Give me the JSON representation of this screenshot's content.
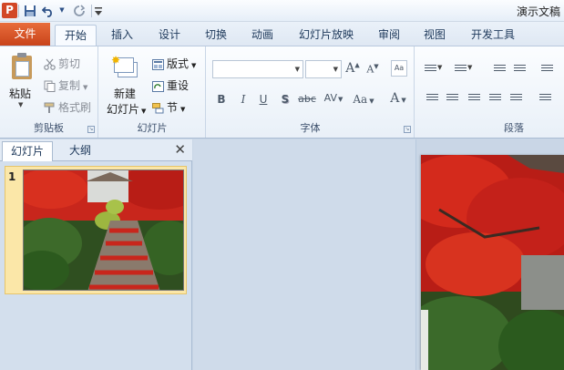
{
  "app": {
    "title": "演示文稿",
    "ppt_icon": "P",
    "qat": [
      "save-icon",
      "undo-icon",
      "redo-icon",
      "customize-icon"
    ]
  },
  "tabs": [
    {
      "label": "文件",
      "kind": "file"
    },
    {
      "label": "开始",
      "kind": "active"
    },
    {
      "label": "插入"
    },
    {
      "label": "设计"
    },
    {
      "label": "切换"
    },
    {
      "label": "动画"
    },
    {
      "label": "幻灯片放映"
    },
    {
      "label": "审阅"
    },
    {
      "label": "视图"
    },
    {
      "label": "开发工具"
    }
  ],
  "ribbon": {
    "clipboard": {
      "label": "剪贴板",
      "paste": "粘贴",
      "cut": "剪切",
      "copy": "复制",
      "format_painter": "格式刷"
    },
    "slides": {
      "label": "幻灯片",
      "new_slide_line1": "新建",
      "new_slide_line2": "幻灯片",
      "layout": "版式",
      "reset": "重设",
      "section": "节"
    },
    "font": {
      "label": "字体",
      "font_name": "",
      "font_size": "",
      "grow": "A",
      "shrink": "A",
      "bold": "B",
      "italic": "I",
      "underline": "U",
      "shadow": "S",
      "strike": "abc",
      "spacing": "AV",
      "case": "Aa",
      "color": "A"
    },
    "paragraph": {
      "label": "段落"
    }
  },
  "leftpane": {
    "tab_slides": "幻灯片",
    "tab_outline": "大纲",
    "slide_number": "1"
  },
  "colors": {
    "file_tab": "#d24726",
    "accent": "#2b579a",
    "thumb_selected": "#fbe7a8"
  }
}
